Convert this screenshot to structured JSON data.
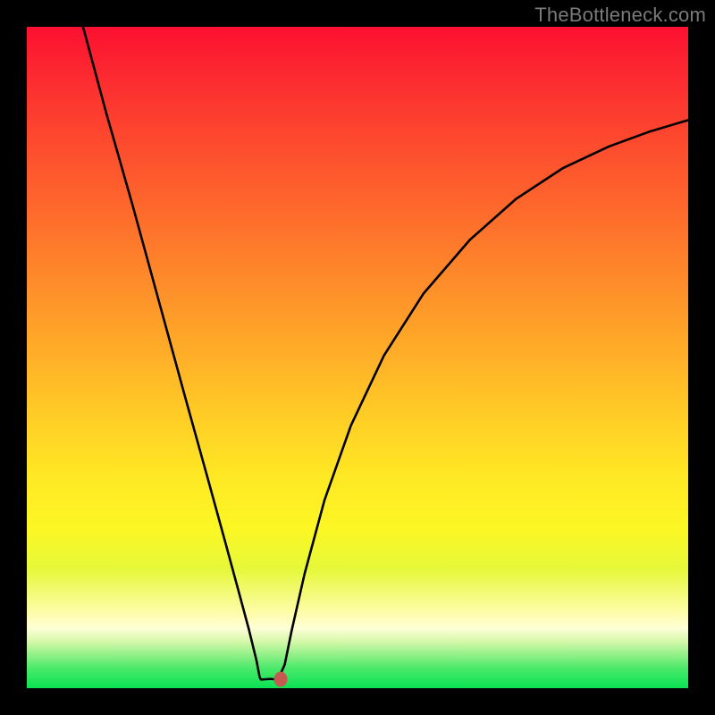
{
  "watermark": "TheBottleneck.com",
  "colors": {
    "frame": "#000000",
    "curve": "#000000",
    "marker": "#c45a52",
    "gradient_top": "#fc1030",
    "gradient_bottom": "#0ae253"
  },
  "chart_data": {
    "type": "line",
    "note": "Values estimated from pixel positions; no axis ticks or labels present in source image. x spans [0,1] across plot width; y is fraction of plot height from bottom (0=bottom, 1=top).",
    "title": "",
    "xlabel": "",
    "ylabel": "",
    "xlim": [
      0,
      1
    ],
    "ylim": [
      0,
      1
    ],
    "series": [
      {
        "name": "curve",
        "points": [
          {
            "x": 0.085,
            "y": 1.0
          },
          {
            "x": 0.12,
            "y": 0.87
          },
          {
            "x": 0.16,
            "y": 0.73
          },
          {
            "x": 0.2,
            "y": 0.584
          },
          {
            "x": 0.24,
            "y": 0.438
          },
          {
            "x": 0.275,
            "y": 0.312
          },
          {
            "x": 0.3,
            "y": 0.221
          },
          {
            "x": 0.322,
            "y": 0.14
          },
          {
            "x": 0.336,
            "y": 0.088
          },
          {
            "x": 0.347,
            "y": 0.043
          },
          {
            "x": 0.352,
            "y": 0.017
          },
          {
            "x": 0.354,
            "y": 0.013
          },
          {
            "x": 0.368,
            "y": 0.014
          },
          {
            "x": 0.38,
            "y": 0.013
          },
          {
            "x": 0.39,
            "y": 0.036
          },
          {
            "x": 0.4,
            "y": 0.085
          },
          {
            "x": 0.42,
            "y": 0.173
          },
          {
            "x": 0.45,
            "y": 0.284
          },
          {
            "x": 0.49,
            "y": 0.397
          },
          {
            "x": 0.54,
            "y": 0.503
          },
          {
            "x": 0.6,
            "y": 0.597
          },
          {
            "x": 0.67,
            "y": 0.678
          },
          {
            "x": 0.74,
            "y": 0.74
          },
          {
            "x": 0.81,
            "y": 0.786
          },
          {
            "x": 0.88,
            "y": 0.819
          },
          {
            "x": 0.94,
            "y": 0.841
          },
          {
            "x": 1.0,
            "y": 0.859
          }
        ]
      }
    ],
    "marker": {
      "x": 0.384,
      "y": 0.013
    }
  }
}
